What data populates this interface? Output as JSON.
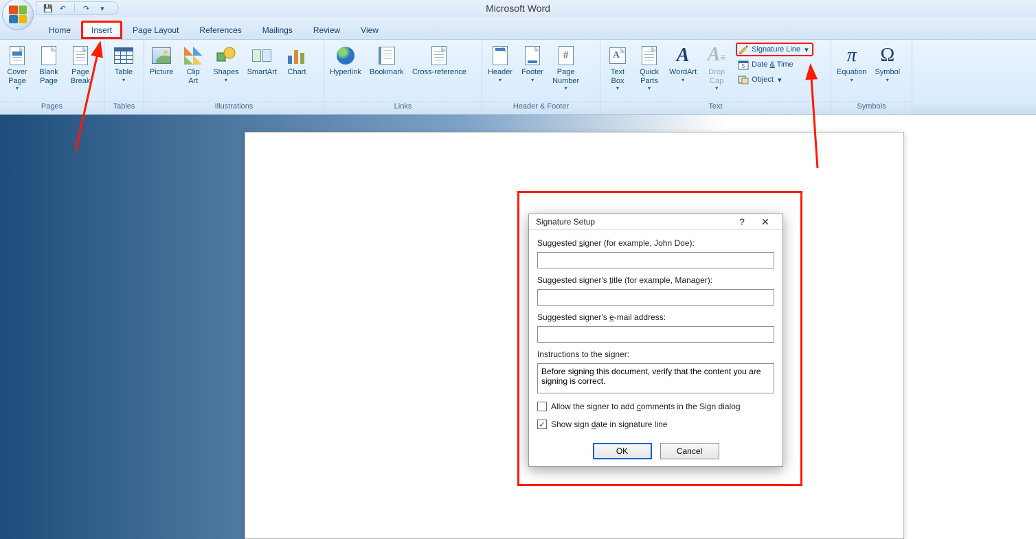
{
  "app_title": "Microsoft Word",
  "qat": {
    "save": "💾",
    "undo": "↶",
    "redo": "↷",
    "more": "▾"
  },
  "tabs": [
    "Home",
    "Insert",
    "Page Layout",
    "References",
    "Mailings",
    "Review",
    "View"
  ],
  "active_tab": "Insert",
  "ribbon": {
    "pages": {
      "label": "Pages",
      "cover": "Cover\nPage",
      "blank": "Blank\nPage",
      "break": "Page\nBreak"
    },
    "tables": {
      "label": "Tables",
      "table": "Table"
    },
    "illus": {
      "label": "Illustrations",
      "picture": "Picture",
      "clip": "Clip\nArt",
      "shapes": "Shapes",
      "smart": "SmartArt",
      "chart": "Chart"
    },
    "links": {
      "label": "Links",
      "hyper": "Hyperlink",
      "book": "Bookmark",
      "xref": "Cross-reference"
    },
    "hf": {
      "label": "Header & Footer",
      "header": "Header",
      "footer": "Footer",
      "num": "Page\nNumber"
    },
    "text": {
      "label": "Text",
      "tbox": "Text\nBox",
      "qp": "Quick\nParts",
      "wa": "WordArt",
      "dc": "Drop\nCap",
      "sig": "Signature Line",
      "dt": "Date & Time",
      "obj": "Object"
    },
    "symbols": {
      "label": "Symbols",
      "eq": "Equation",
      "sym": "Symbol"
    }
  },
  "dialog": {
    "title": "Signature Setup",
    "l1": "Suggested signer (for example, John Doe):",
    "l1_underline_char": "s",
    "l2": "Suggested signer's title (for example, Manager):",
    "l2_underline_char": "t",
    "l3": "Suggested signer's e-mail address:",
    "l3_underline_char": "e",
    "l4": "Instructions to the signer:",
    "v1": "",
    "v2": "",
    "v3": "",
    "instructions": "Before signing this document, verify that the content you are signing is correct.",
    "chk1": "Allow the signer to add comments in the Sign dialog",
    "chk1_checked": false,
    "chk1_underline_char": "c",
    "chk2": "Show sign date in signature line",
    "chk2_checked": true,
    "chk2_underline_char": "d",
    "ok": "OK",
    "cancel": "Cancel",
    "help": "?",
    "close": "✕"
  }
}
